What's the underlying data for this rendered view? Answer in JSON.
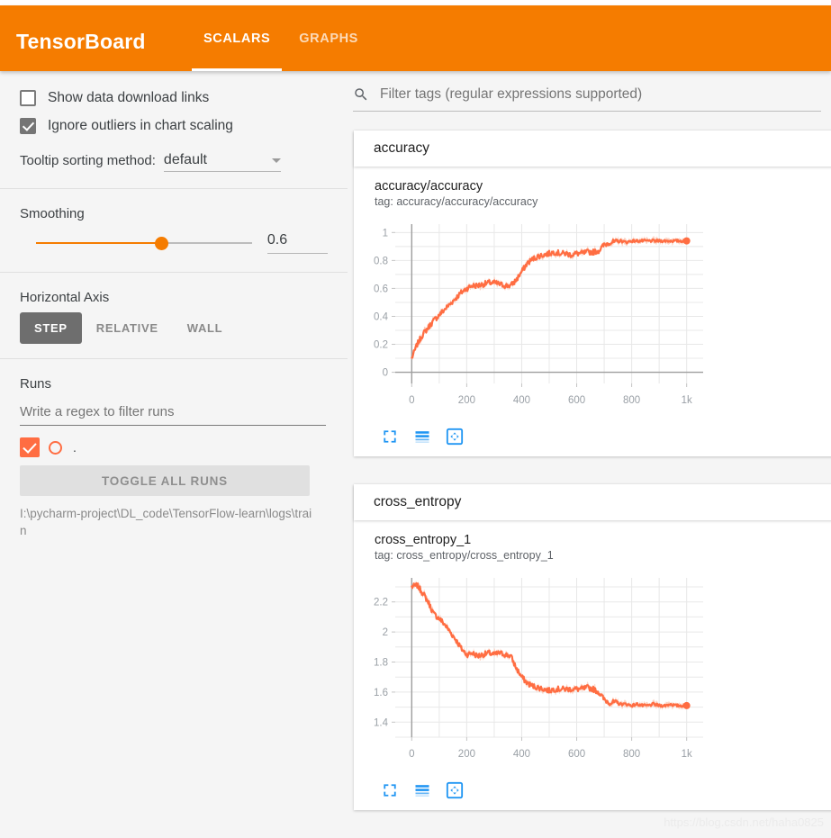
{
  "header": {
    "brand": "TensorBoard",
    "tabs": [
      {
        "label": "SCALARS",
        "active": true
      },
      {
        "label": "GRAPHS",
        "active": false
      }
    ]
  },
  "sidebar": {
    "checkboxes": [
      {
        "label": "Show data download links",
        "checked": false
      },
      {
        "label": "Ignore outliers in chart scaling",
        "checked": true
      }
    ],
    "tooltip": {
      "label": "Tooltip sorting method:",
      "value": "default"
    },
    "smoothing": {
      "title": "Smoothing",
      "value": "0.6"
    },
    "horizontal_axis": {
      "title": "Horizontal Axis",
      "options": [
        "STEP",
        "RELATIVE",
        "WALL"
      ],
      "selected": "STEP"
    },
    "runs": {
      "title": "Runs",
      "filter_placeholder": "Write a regex to filter runs",
      "run_name": ".",
      "toggle_label": "TOGGLE ALL RUNS",
      "path": "I:\\pycharm-project\\DL_code\\TensorFlow-learn\\logs\\train",
      "color": "#ff6d42"
    }
  },
  "search": {
    "placeholder": "Filter tags (regular expressions supported)",
    "icon": "search-icon"
  },
  "cards": [
    {
      "group": "accuracy",
      "chart_title": "accuracy/accuracy",
      "chart_tag": "tag: accuracy/accuracy/accuracy",
      "icons": [
        "fullscreen-icon",
        "data-series-icon",
        "fit-domain-icon"
      ]
    },
    {
      "group": "cross_entropy",
      "chart_title": "cross_entropy_1",
      "chart_tag": "tag: cross_entropy/cross_entropy_1",
      "icons": [
        "fullscreen-icon",
        "data-series-icon",
        "fit-domain-icon"
      ]
    }
  ],
  "watermark": "https://blog.csdn.net/haha0825",
  "colors": {
    "accent_orange": "#f57c00",
    "series": "#ff6d42",
    "series_faded": "#fbc4b0"
  },
  "chart_data": [
    {
      "type": "line",
      "title": "accuracy/accuracy",
      "xlabel": "",
      "ylabel": "",
      "xlim": [
        -60,
        1060
      ],
      "ylim": [
        -0.08,
        1.06
      ],
      "xticks": [
        0,
        200,
        400,
        600,
        800,
        1000
      ],
      "xticklabels": [
        "0",
        "200",
        "400",
        "600",
        "800",
        "1k"
      ],
      "yticks": [
        0,
        0.2,
        0.4,
        0.6,
        0.8,
        1
      ],
      "yticklabels": [
        "0",
        "0.2",
        "0.4",
        "0.6",
        "0.8",
        "1"
      ],
      "grid": true,
      "legend": false,
      "series": [
        {
          "name": "I:\\pycharm-project\\DL_code\\TensorFlow-learn\\logs\\train",
          "color": "#ff6d42",
          "x": [
            0,
            20,
            40,
            60,
            80,
            100,
            120,
            140,
            160,
            180,
            200,
            220,
            240,
            260,
            280,
            300,
            320,
            340,
            360,
            380,
            400,
            420,
            440,
            460,
            480,
            500,
            520,
            540,
            560,
            580,
            600,
            620,
            640,
            660,
            680,
            700,
            720,
            740,
            760,
            780,
            800,
            820,
            840,
            860,
            880,
            900,
            920,
            940,
            960,
            980,
            1000
          ],
          "y": [
            0.1,
            0.2,
            0.27,
            0.32,
            0.37,
            0.41,
            0.45,
            0.49,
            0.53,
            0.57,
            0.6,
            0.62,
            0.62,
            0.63,
            0.64,
            0.64,
            0.63,
            0.62,
            0.62,
            0.66,
            0.72,
            0.78,
            0.81,
            0.83,
            0.84,
            0.85,
            0.86,
            0.85,
            0.85,
            0.84,
            0.85,
            0.85,
            0.86,
            0.86,
            0.87,
            0.91,
            0.93,
            0.93,
            0.94,
            0.93,
            0.94,
            0.94,
            0.94,
            0.94,
            0.94,
            0.94,
            0.94,
            0.94,
            0.94,
            0.94,
            0.94
          ],
          "last_point": {
            "x": 1000,
            "y": 0.94
          }
        }
      ]
    },
    {
      "type": "line",
      "title": "cross_entropy_1",
      "xlabel": "",
      "ylabel": "",
      "xlim": [
        -60,
        1060
      ],
      "ylim": [
        1.3,
        2.36
      ],
      "xticks": [
        0,
        200,
        400,
        600,
        800,
        1000
      ],
      "xticklabels": [
        "0",
        "200",
        "400",
        "600",
        "800",
        "1k"
      ],
      "yticks": [
        1.4,
        1.6,
        1.8,
        2.0,
        2.2
      ],
      "yticklabels": [
        "1.4",
        "1.6",
        "1.8",
        "2",
        "2.2"
      ],
      "grid": true,
      "legend": false,
      "series": [
        {
          "name": "I:\\pycharm-project\\DL_code\\TensorFlow-learn\\logs\\train",
          "color": "#ff6d42",
          "x": [
            0,
            20,
            40,
            60,
            80,
            100,
            120,
            140,
            160,
            180,
            200,
            220,
            240,
            260,
            280,
            300,
            320,
            340,
            360,
            380,
            400,
            420,
            440,
            460,
            480,
            500,
            520,
            540,
            560,
            580,
            600,
            620,
            640,
            660,
            680,
            700,
            720,
            740,
            760,
            780,
            800,
            820,
            840,
            860,
            880,
            900,
            920,
            940,
            960,
            980,
            1000
          ],
          "y": [
            2.3,
            2.31,
            2.26,
            2.2,
            2.12,
            2.09,
            2.05,
            2.0,
            1.95,
            1.89,
            1.85,
            1.86,
            1.84,
            1.85,
            1.86,
            1.85,
            1.86,
            1.85,
            1.84,
            1.76,
            1.7,
            1.66,
            1.64,
            1.63,
            1.62,
            1.61,
            1.62,
            1.62,
            1.62,
            1.62,
            1.62,
            1.62,
            1.63,
            1.62,
            1.6,
            1.55,
            1.53,
            1.53,
            1.52,
            1.52,
            1.51,
            1.52,
            1.51,
            1.51,
            1.52,
            1.51,
            1.51,
            1.52,
            1.51,
            1.51,
            1.51
          ],
          "last_point": {
            "x": 1000,
            "y": 1.51
          }
        }
      ]
    }
  ]
}
